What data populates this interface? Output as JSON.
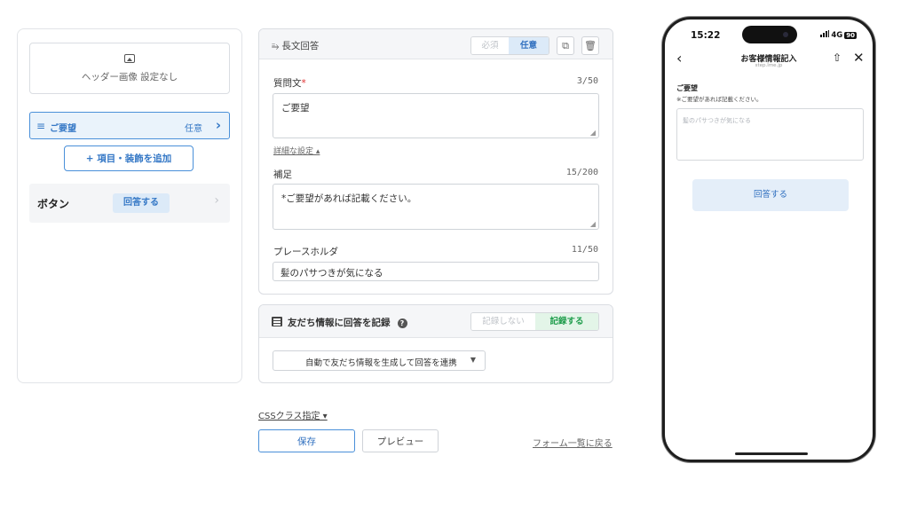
{
  "left": {
    "header_image_label": "ヘッダー画像 設定なし",
    "item": {
      "name": "ご要望",
      "badge": "任意"
    },
    "add_button": "+ 項目・装飾を追加",
    "button_row": {
      "label": "ボタン",
      "pill": "回答する"
    }
  },
  "card1": {
    "title": "長文回答",
    "toggle": {
      "required": "必須",
      "optional": "任意",
      "selected": "任意"
    },
    "question": {
      "label": "質問文",
      "required_mark": "*",
      "count": "3/50",
      "value": "ご要望"
    },
    "detail_link": "詳細な設定",
    "supplement": {
      "label": "補足",
      "count": "15/200",
      "value": "*ご要望があれば記載ください。"
    },
    "placeholder_field": {
      "label": "プレースホルダ",
      "count": "11/50",
      "value": "髪のパサつきが気になる"
    }
  },
  "card2": {
    "title": "友だち情報に回答を記録",
    "toggle": {
      "off": "記録しない",
      "on": "記録する",
      "selected": "記録する"
    },
    "select_value": "自動で友だち情報を生成して回答を連携"
  },
  "footer": {
    "css_link": "CSSクラス指定",
    "save": "保存",
    "preview": "プレビュー",
    "back_link": "フォーム一覧に戻る"
  },
  "phone": {
    "time": "15:22",
    "network": "4G",
    "battery": "90",
    "title": "お客様情報記入",
    "subtitle": "step.lme.jp",
    "field_label": "ご要望",
    "field_note": "※ご要望があれば記載ください。",
    "placeholder": "髪のパサつきが気になる",
    "submit": "回答する"
  },
  "colors": {
    "accent": "#3578c6",
    "green": "#1f9d4c",
    "required": "#e03030"
  }
}
